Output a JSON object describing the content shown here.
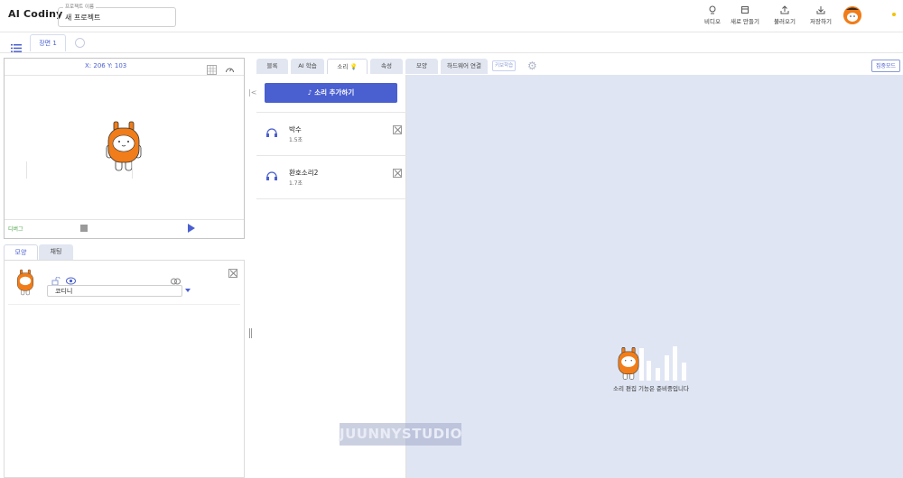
{
  "app": {
    "logo": "AI Codiny",
    "project_label": "프로젝트 이름",
    "project_name": "새 프로젝트"
  },
  "header_buttons": [
    {
      "label": "비디오",
      "icon": "video-icon"
    },
    {
      "label": "새로 만들기",
      "icon": "new-file-icon"
    },
    {
      "label": "불러오기",
      "icon": "upload-icon"
    },
    {
      "label": "저장하기",
      "icon": "download-icon"
    }
  ],
  "scenes": {
    "active": "장면 1"
  },
  "stage": {
    "coords": "X: 206 Y: 103",
    "debug_label": "디버그"
  },
  "object_panel": {
    "tabs": [
      "모양",
      "채팅"
    ],
    "object_name": "코디니"
  },
  "tabs": [
    {
      "label": "블록",
      "active": false
    },
    {
      "label": "AI 학습",
      "active": false
    },
    {
      "label": "소리",
      "active": true
    },
    {
      "label": "속성",
      "active": false
    },
    {
      "label": "모양",
      "active": false
    },
    {
      "label": "하드웨어 연결",
      "active": false
    }
  ],
  "tab_extra": "키보학습",
  "focus_mode_label": "집중모드",
  "sound_panel": {
    "add_label": "소리 추가하기",
    "sounds": [
      {
        "name": "박수",
        "duration": "1.5초"
      },
      {
        "name": "환호소리2",
        "duration": "1.7초"
      }
    ]
  },
  "editor": {
    "message": "소리 편집 기능은 준비중입니다"
  },
  "watermark": "JUUNNYSTUDIO",
  "colors": {
    "accent": "#4a5fd0",
    "character": "#f07d1a",
    "editor_bg": "#dfe5f3"
  }
}
